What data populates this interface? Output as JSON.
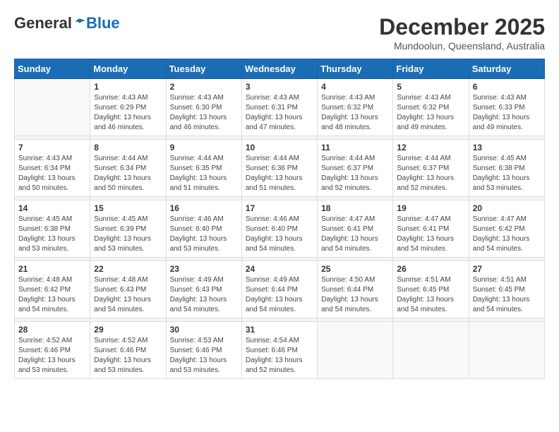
{
  "header": {
    "logo_general": "General",
    "logo_blue": "Blue",
    "month_title": "December 2025",
    "location": "Mundoolun, Queensland, Australia"
  },
  "weekdays": [
    "Sunday",
    "Monday",
    "Tuesday",
    "Wednesday",
    "Thursday",
    "Friday",
    "Saturday"
  ],
  "weeks": [
    [
      {
        "day": "",
        "info": ""
      },
      {
        "day": "1",
        "info": "Sunrise: 4:43 AM\nSunset: 6:29 PM\nDaylight: 13 hours\nand 46 minutes."
      },
      {
        "day": "2",
        "info": "Sunrise: 4:43 AM\nSunset: 6:30 PM\nDaylight: 13 hours\nand 46 minutes."
      },
      {
        "day": "3",
        "info": "Sunrise: 4:43 AM\nSunset: 6:31 PM\nDaylight: 13 hours\nand 47 minutes."
      },
      {
        "day": "4",
        "info": "Sunrise: 4:43 AM\nSunset: 6:32 PM\nDaylight: 13 hours\nand 48 minutes."
      },
      {
        "day": "5",
        "info": "Sunrise: 4:43 AM\nSunset: 6:32 PM\nDaylight: 13 hours\nand 49 minutes."
      },
      {
        "day": "6",
        "info": "Sunrise: 4:43 AM\nSunset: 6:33 PM\nDaylight: 13 hours\nand 49 minutes."
      }
    ],
    [
      {
        "day": "7",
        "info": "Sunrise: 4:43 AM\nSunset: 6:34 PM\nDaylight: 13 hours\nand 50 minutes."
      },
      {
        "day": "8",
        "info": "Sunrise: 4:44 AM\nSunset: 6:34 PM\nDaylight: 13 hours\nand 50 minutes."
      },
      {
        "day": "9",
        "info": "Sunrise: 4:44 AM\nSunset: 6:35 PM\nDaylight: 13 hours\nand 51 minutes."
      },
      {
        "day": "10",
        "info": "Sunrise: 4:44 AM\nSunset: 6:36 PM\nDaylight: 13 hours\nand 51 minutes."
      },
      {
        "day": "11",
        "info": "Sunrise: 4:44 AM\nSunset: 6:37 PM\nDaylight: 13 hours\nand 52 minutes."
      },
      {
        "day": "12",
        "info": "Sunrise: 4:44 AM\nSunset: 6:37 PM\nDaylight: 13 hours\nand 52 minutes."
      },
      {
        "day": "13",
        "info": "Sunrise: 4:45 AM\nSunset: 6:38 PM\nDaylight: 13 hours\nand 53 minutes."
      }
    ],
    [
      {
        "day": "14",
        "info": "Sunrise: 4:45 AM\nSunset: 6:38 PM\nDaylight: 13 hours\nand 53 minutes."
      },
      {
        "day": "15",
        "info": "Sunrise: 4:45 AM\nSunset: 6:39 PM\nDaylight: 13 hours\nand 53 minutes."
      },
      {
        "day": "16",
        "info": "Sunrise: 4:46 AM\nSunset: 6:40 PM\nDaylight: 13 hours\nand 53 minutes."
      },
      {
        "day": "17",
        "info": "Sunrise: 4:46 AM\nSunset: 6:40 PM\nDaylight: 13 hours\nand 54 minutes."
      },
      {
        "day": "18",
        "info": "Sunrise: 4:47 AM\nSunset: 6:41 PM\nDaylight: 13 hours\nand 54 minutes."
      },
      {
        "day": "19",
        "info": "Sunrise: 4:47 AM\nSunset: 6:41 PM\nDaylight: 13 hours\nand 54 minutes."
      },
      {
        "day": "20",
        "info": "Sunrise: 4:47 AM\nSunset: 6:42 PM\nDaylight: 13 hours\nand 54 minutes."
      }
    ],
    [
      {
        "day": "21",
        "info": "Sunrise: 4:48 AM\nSunset: 6:42 PM\nDaylight: 13 hours\nand 54 minutes."
      },
      {
        "day": "22",
        "info": "Sunrise: 4:48 AM\nSunset: 6:43 PM\nDaylight: 13 hours\nand 54 minutes."
      },
      {
        "day": "23",
        "info": "Sunrise: 4:49 AM\nSunset: 6:43 PM\nDaylight: 13 hours\nand 54 minutes."
      },
      {
        "day": "24",
        "info": "Sunrise: 4:49 AM\nSunset: 6:44 PM\nDaylight: 13 hours\nand 54 minutes."
      },
      {
        "day": "25",
        "info": "Sunrise: 4:50 AM\nSunset: 6:44 PM\nDaylight: 13 hours\nand 54 minutes."
      },
      {
        "day": "26",
        "info": "Sunrise: 4:51 AM\nSunset: 6:45 PM\nDaylight: 13 hours\nand 54 minutes."
      },
      {
        "day": "27",
        "info": "Sunrise: 4:51 AM\nSunset: 6:45 PM\nDaylight: 13 hours\nand 54 minutes."
      }
    ],
    [
      {
        "day": "28",
        "info": "Sunrise: 4:52 AM\nSunset: 6:46 PM\nDaylight: 13 hours\nand 53 minutes."
      },
      {
        "day": "29",
        "info": "Sunrise: 4:52 AM\nSunset: 6:46 PM\nDaylight: 13 hours\nand 53 minutes."
      },
      {
        "day": "30",
        "info": "Sunrise: 4:53 AM\nSunset: 6:46 PM\nDaylight: 13 hours\nand 53 minutes."
      },
      {
        "day": "31",
        "info": "Sunrise: 4:54 AM\nSunset: 6:46 PM\nDaylight: 13 hours\nand 52 minutes."
      },
      {
        "day": "",
        "info": ""
      },
      {
        "day": "",
        "info": ""
      },
      {
        "day": "",
        "info": ""
      }
    ]
  ]
}
